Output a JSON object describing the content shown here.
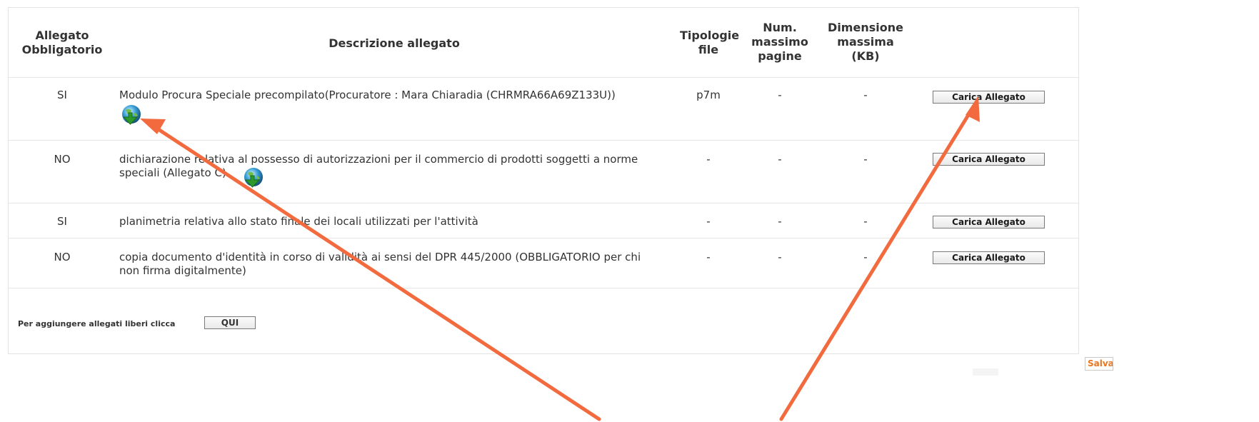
{
  "table": {
    "headers": {
      "obbligatorio": [
        "Allegato",
        "Obbligatorio"
      ],
      "descrizione": "Descrizione allegato",
      "tipologie": [
        "Tipologie",
        "file"
      ],
      "num_pagine": [
        "Num.",
        "massimo",
        "pagine"
      ],
      "dimensione": [
        "Dimensione",
        "massima",
        "(KB)"
      ]
    },
    "rows": [
      {
        "obbligatorio": "SI",
        "descrizione": "Modulo Procura Speciale precompilato(Procuratore : Mara Chiaradia (CHRMRA66A69Z133U))",
        "tipologie": "p7m",
        "num_pagine": "-",
        "dimensione": "-",
        "button": "Carica Allegato",
        "icon": "download-globe-icon"
      },
      {
        "obbligatorio": "NO",
        "descrizione_l1": "dichiarazione relativa al possesso di autorizzazioni per il commercio di prodotti soggetti a norme",
        "descrizione_l2": "speciali (Allegato C)",
        "tipologie": "-",
        "num_pagine": "-",
        "dimensione": "-",
        "button": "Carica Allegato",
        "icon": "download-globe-icon"
      },
      {
        "obbligatorio": "SI",
        "descrizione": "planimetria relativa allo stato finale dei locali utilizzati per l'attività",
        "tipologie": "-",
        "num_pagine": "-",
        "dimensione": "-",
        "button": "Carica Allegato"
      },
      {
        "obbligatorio": "NO",
        "descrizione_l1": "copia documento d'identità in corso di validità ai sensi del DPR 445/2000 (OBBLIGATORIO per chi",
        "descrizione_l2": "non firma digitalmente)",
        "tipologie": "-",
        "num_pagine": "-",
        "dimensione": "-",
        "button": "Carica Allegato"
      }
    ]
  },
  "footer": {
    "label": "Per aggiungere allegati liberi clicca",
    "button": "QUI"
  },
  "actions": {
    "salva": "Salva"
  },
  "colors": {
    "annotation_arrow": "#f26a3d",
    "salva_text": "#e87722",
    "border": "#e3e3e3"
  }
}
